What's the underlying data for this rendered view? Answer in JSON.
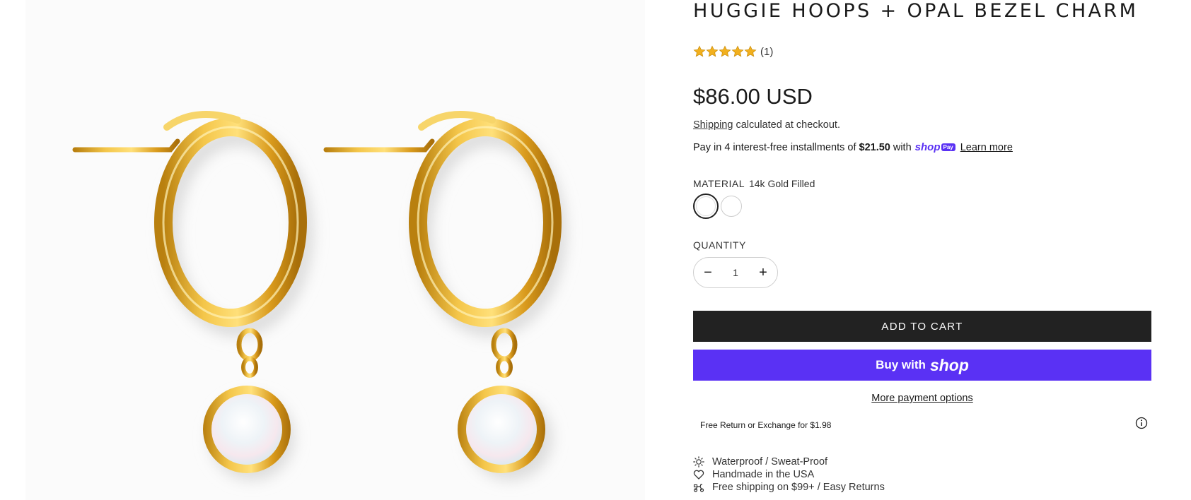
{
  "product": {
    "title": "HUGGIE HOOPS + OPAL BEZEL CHARM",
    "review_count": "(1)",
    "rating_stars": 5,
    "price": "$86.00 USD"
  },
  "shipping": {
    "link_label": "Shipping",
    "note": "calculated at checkout."
  },
  "installments": {
    "prefix": "Pay in 4 interest-free installments of",
    "amount": "$21.50",
    "with": "with",
    "shop_pay_logo": "shop",
    "pay_badge": "Pay",
    "learn_more": "Learn more"
  },
  "material": {
    "label": "MATERIAL",
    "selected_value": "14k Gold Filled"
  },
  "quantity": {
    "label": "QUANTITY",
    "value": "1",
    "minus": "−",
    "plus": "+"
  },
  "buttons": {
    "add_to_cart": "ADD TO CART",
    "buy_with": "Buy with",
    "shop_word": "shop",
    "more_payment": "More payment options"
  },
  "returns": {
    "text": "Free Return or Exchange for $1.98"
  },
  "features": [
    {
      "icon": "sun-icon",
      "label": "Waterproof / Sweat-Proof"
    },
    {
      "icon": "heart-icon",
      "label": "Handmade in the USA"
    },
    {
      "icon": "delivery-scooter-icon",
      "label": "Free shipping on $99+ / Easy Returns"
    }
  ],
  "colors": {
    "star": "#f2b01e",
    "gold": "#e7b22a",
    "shop_pay": "#5a31f4",
    "add_to_cart_bg": "#222222"
  }
}
